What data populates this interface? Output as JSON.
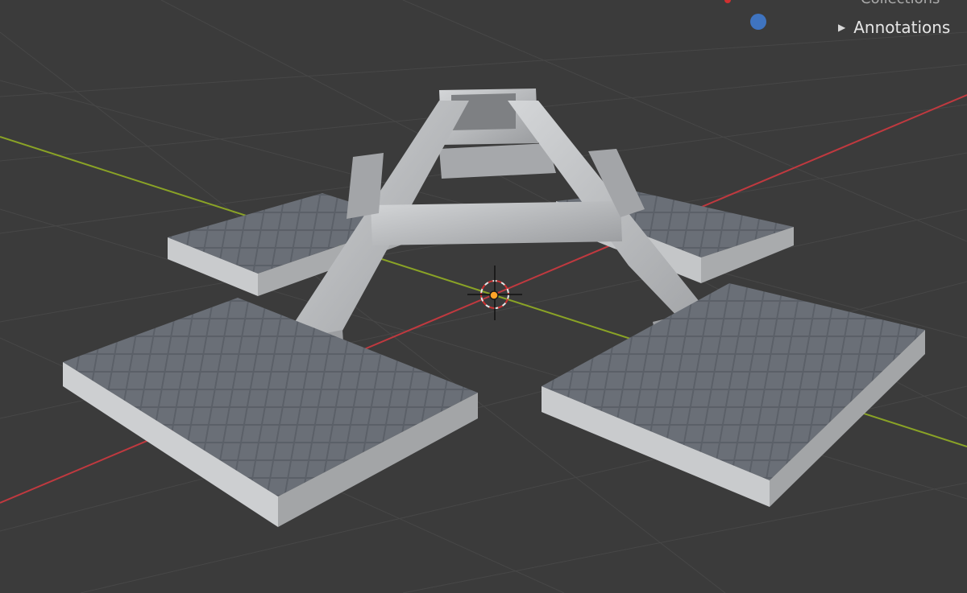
{
  "outliner": {
    "collections_label": "Collections",
    "annotations_label": "Annotations",
    "expand_icon": "triangle-right-icon"
  },
  "viewport": {
    "background": "#3b3b3b",
    "grid_color": "#4a4a4a",
    "axis_x_color": "#c0393f",
    "axis_y_color": "#8aa326"
  },
  "model": {
    "metal_color": "#b9bbbd",
    "grate_color": "#5b6068",
    "cursor": "3d-cursor-icon",
    "origin": "origin-point-icon"
  }
}
